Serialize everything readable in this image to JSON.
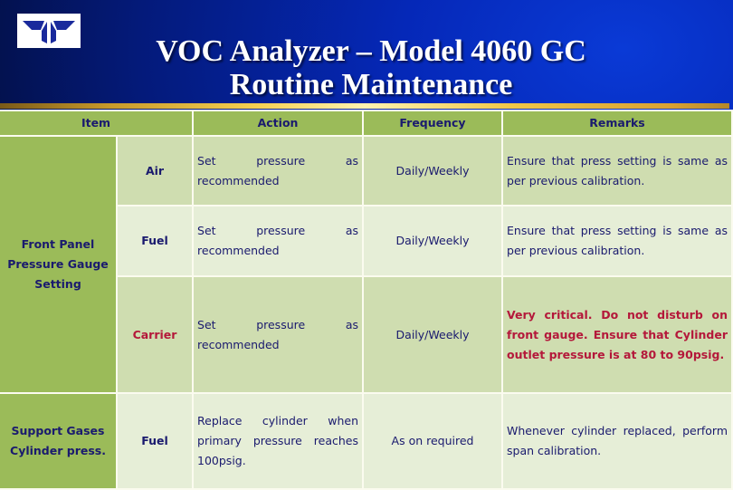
{
  "header": {
    "title_line1": "VOC Analyzer – Model 4060 GC",
    "title_line2": "Routine Maintenance",
    "logo": "teledyne-logo-icon"
  },
  "colors": {
    "header_cell": "#9bbb59",
    "row_dark": "#cfddb0",
    "row_light": "#e6eed7",
    "text": "#1a1a6e",
    "critical": "#b4183a"
  },
  "table": {
    "columns": [
      "Item",
      "Action",
      "Frequency",
      "Remarks"
    ],
    "groups": [
      {
        "item": "Front Panel Pressure Gauge Setting",
        "rows": [
          {
            "sub": "Air",
            "action": "Set pressure as recommended",
            "frequency": "Daily/Weekly",
            "remarks": "Ensure that press setting is same as per previous calibration.",
            "critical": false
          },
          {
            "sub": "Fuel",
            "action": "Set pressure as recommended",
            "frequency": "Daily/Weekly",
            "remarks": "Ensure that press setting is same as per previous calibration.",
            "critical": false
          },
          {
            "sub": "Carrier",
            "action": "Set pressure as recommended",
            "frequency": "Daily/Weekly",
            "remarks": "Very critical. Do not disturb on front gauge. Ensure that Cylinder outlet pressure is at 80 to 90psig.",
            "critical": true
          }
        ]
      },
      {
        "item": "Support Gases Cylinder press.",
        "rows": [
          {
            "sub": "Fuel",
            "action": "Replace cylinder when primary pressure reaches 100psig.",
            "frequency": "As on required",
            "remarks": "Whenever cylinder replaced, perform span calibration.",
            "critical": false
          }
        ]
      }
    ]
  }
}
